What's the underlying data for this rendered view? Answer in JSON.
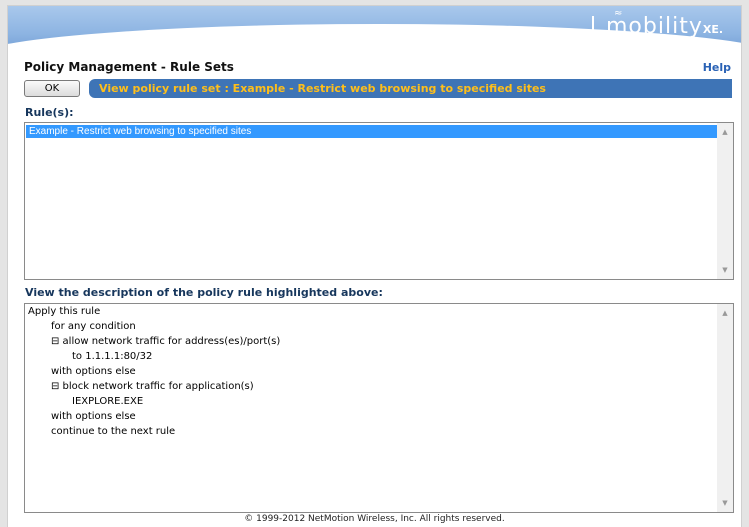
{
  "header": {
    "logo_text": "mobility",
    "logo_suffix": "XE",
    "logo_dot": "."
  },
  "page": {
    "title": "Policy Management - Rule Sets",
    "help_label": "Help"
  },
  "toolbar": {
    "ok_label": "OK",
    "view_caption": "View policy rule set  :  Example - Restrict web browsing to specified sites"
  },
  "rules": {
    "label": "Rule(s):",
    "items": [
      {
        "label": "Example - Restrict web browsing to specified sites",
        "selected": true
      }
    ]
  },
  "description": {
    "label": "View the description of the policy rule highlighted above:",
    "lines": [
      "Apply this rule",
      "for any condition",
      "⊟ allow network traffic for address(es)/port(s)",
      "to 1.1.1.1:80/32",
      "with options else",
      "⊟ block network traffic for application(s)",
      "IEXPLORE.EXE",
      "with options else",
      "continue to the next rule"
    ]
  },
  "footer": {
    "copyright": "© 1999-2012 NetMotion Wireless, Inc. All rights reserved."
  },
  "colors": {
    "accent_bar": "#3e74b6",
    "caption_text": "#ffbf1a",
    "selection": "#3399ff"
  },
  "icons": {
    "scroll_up": "up-arrow",
    "scroll_down": "down-arrow",
    "collapse": "minus-box"
  }
}
